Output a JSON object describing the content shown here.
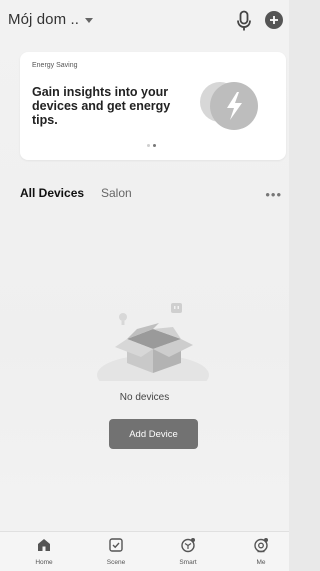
{
  "header": {
    "home_name": "Mój dom ..",
    "mic_icon": "microphone-icon",
    "add_icon": "plus-circle-icon"
  },
  "energy_card": {
    "tag": "Energy Saving",
    "headline": "Gain insights into your devices and get energy tips.",
    "icon": "lightning-bolt-icon"
  },
  "tabs": [
    {
      "label": "All Devices",
      "active": true
    },
    {
      "label": "Salon",
      "active": false
    }
  ],
  "empty_state": {
    "message": "No devices",
    "button_label": "Add Device"
  },
  "bottom_nav": [
    {
      "label": "Home",
      "icon": "home-icon"
    },
    {
      "label": "Scene",
      "icon": "checkbox-icon"
    },
    {
      "label": "Smart",
      "icon": "cube-icon"
    },
    {
      "label": "Me",
      "icon": "user-icon"
    }
  ],
  "colors": {
    "background": "#efefef",
    "card": "#ffffff",
    "button": "#727272",
    "text_primary": "#222222",
    "text_secondary": "#666666"
  }
}
